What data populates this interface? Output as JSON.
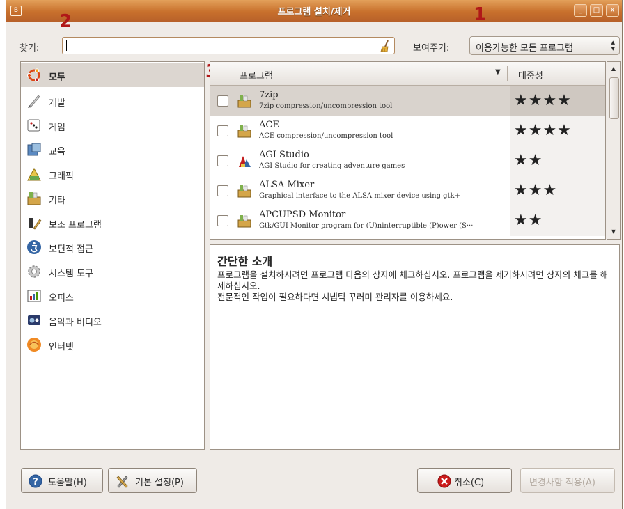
{
  "window": {
    "title": "프로그램 설치/제거",
    "menu_glyph": "B",
    "controls": {
      "minimize": "_",
      "maximize": "□",
      "close": "x"
    }
  },
  "annotations": [
    "1",
    "2",
    "3"
  ],
  "search": {
    "label": "찾기:",
    "value": ""
  },
  "filter": {
    "label": "보여주기:",
    "selected": "이용가능한 모든 프로그램",
    "arrow": "▴▾"
  },
  "categories": [
    {
      "name": "모두",
      "icon": "ubuntu-logo-icon",
      "selected": true
    },
    {
      "name": "개발",
      "icon": "brush-icon"
    },
    {
      "name": "게임",
      "icon": "dice-icon"
    },
    {
      "name": "교육",
      "icon": "education-icon"
    },
    {
      "name": "그래픽",
      "icon": "graphics-icon"
    },
    {
      "name": "기타",
      "icon": "package-icon"
    },
    {
      "name": "보조 프로그램",
      "icon": "tools-icon"
    },
    {
      "name": "보편적 접근",
      "icon": "accessibility-icon"
    },
    {
      "name": "시스템 도구",
      "icon": "gear-icon"
    },
    {
      "name": "오피스",
      "icon": "office-icon"
    },
    {
      "name": "음악과 비디오",
      "icon": "multimedia-icon"
    },
    {
      "name": "인터넷",
      "icon": "internet-icon"
    }
  ],
  "table": {
    "col_program": "프로그램",
    "col_popularity": "대중성",
    "sort_glyph": "▼",
    "rows": [
      {
        "name": "7zip",
        "desc": "7zip compression/uncompression tool",
        "stars": "★★★★",
        "rating": 4,
        "icon": "package-icon",
        "selected": true
      },
      {
        "name": "ACE",
        "desc": "ACE compression/uncompression tool",
        "stars": "★★★★",
        "rating": 4,
        "icon": "package-icon"
      },
      {
        "name": "AGI Studio",
        "desc": "AGI Studio for creating adventure games",
        "stars": "★★",
        "rating": 2,
        "icon": "agi-studio-icon"
      },
      {
        "name": "ALSA Mixer",
        "desc": "Graphical interface to the ALSA mixer device using gtk+",
        "stars": "★★★",
        "rating": 3,
        "icon": "package-icon"
      },
      {
        "name": "APCUPSD Monitor",
        "desc": "Gtk/GUI Monitor program for (U)ninterruptible (P)ower (S···",
        "stars": "★★",
        "rating": 2,
        "icon": "package-icon"
      }
    ]
  },
  "scroll": {
    "up": "▲",
    "down": "▼"
  },
  "description": {
    "title": "간단한 소개",
    "line1": "프로그램을 설치하시려면 프로그램 다음의 상자에 체크하십시오. 프로그램을 제거하시려면 상자의 체크를 해제하십시오.",
    "line2": "전문적인 작업이 필요하다면 시냅틱 꾸러미 관리자를 이용하세요."
  },
  "buttons": {
    "help": "도움말(H)",
    "preferences": "기본 설정(P)",
    "cancel": "취소(C)",
    "apply": "변경사항 적용(A)"
  },
  "colors": {
    "titlebar": "#c8702c",
    "annotation": "#b01818",
    "selection": "#dcd6d0"
  }
}
